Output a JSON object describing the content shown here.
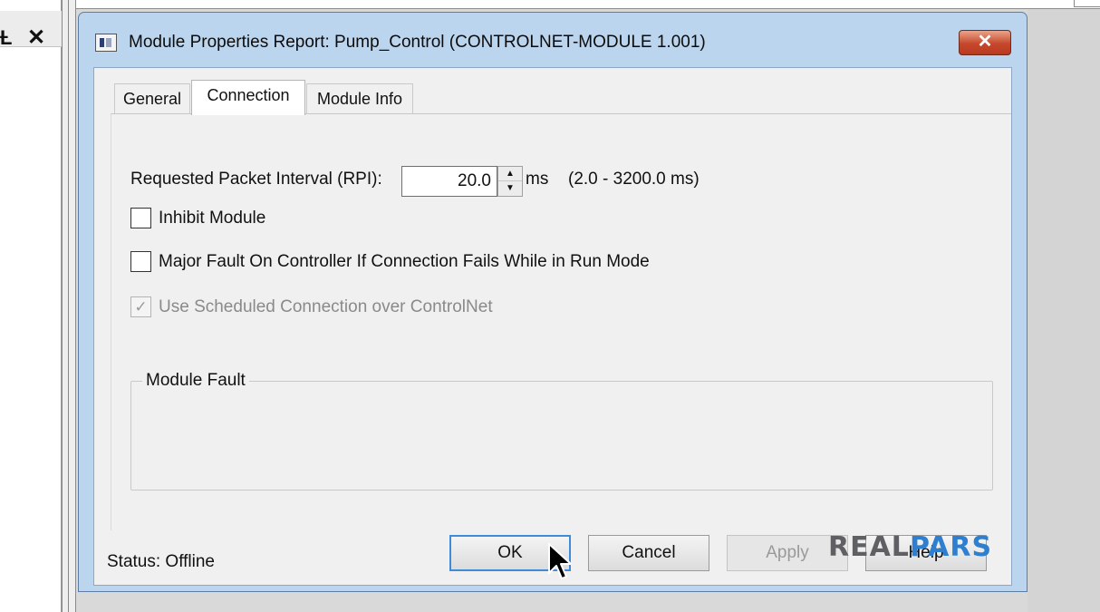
{
  "background": {
    "pin_glyph": "ᵾ",
    "close_glyph": "✕"
  },
  "dialog": {
    "title": "Module Properties Report: Pump_Control (CONTROLNET-MODULE 1.001)",
    "close_glyph": "✕",
    "tabs": [
      {
        "label": "General",
        "active": false
      },
      {
        "label": "Connection",
        "active": true
      },
      {
        "label": "Module Info",
        "active": false
      }
    ],
    "rpi": {
      "label": "Requested Packet Interval (RPI):",
      "value": "20.0",
      "unit": "ms",
      "range": "(2.0 - 3200.0 ms)"
    },
    "checkboxes": [
      {
        "label": "Inhibit Module",
        "checked": false,
        "enabled": true
      },
      {
        "label": "Major Fault On Controller If Connection Fails While in Run Mode",
        "checked": false,
        "enabled": true
      },
      {
        "label": "Use Scheduled Connection over ControlNet",
        "checked": true,
        "enabled": false
      }
    ],
    "module_fault": {
      "legend": "Module Fault"
    },
    "status": "Status:  Offline",
    "buttons": {
      "ok": "OK",
      "cancel": "Cancel",
      "apply": "Apply",
      "help": "Help"
    }
  },
  "watermark": {
    "part1": "REAL",
    "part2": "PARS"
  },
  "colors": {
    "dialog_frame": "#bcd5ee",
    "close_button": "#c7472b",
    "ok_focus": "#3f8bd8",
    "brand_gray": "#5f6063",
    "brand_blue": "#2f7fd1"
  },
  "icons": [
    "pin-icon",
    "close-icon",
    "app-icon",
    "spin-up-icon",
    "spin-down-icon",
    "checkmark-icon",
    "mouse-cursor-icon"
  ]
}
